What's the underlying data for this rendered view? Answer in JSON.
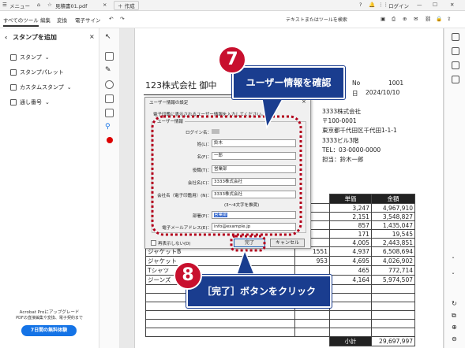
{
  "titlebar": {
    "menu": "メニュー",
    "tab_title": "見積書01.pdf",
    "new_tab": "作成",
    "login": "ログイン"
  },
  "toolbar": {
    "tabs": [
      "すべてのツール",
      "編集",
      "変換",
      "電子サイン"
    ],
    "search_placeholder": "テキストまたはツールを検索"
  },
  "left_panel": {
    "title": "スタンプを追加",
    "items": [
      "スタンプ",
      "スタンプパレット",
      "カスタムスタンプ",
      "通し番号"
    ],
    "promo_line1": "Acrobat Proにアップグレード",
    "promo_line2": "PDFの直接編集や変換、電子契約まで",
    "trial_button": "7日間の無料体験"
  },
  "document": {
    "company_title": "123株式会社 御中",
    "no_label": "No",
    "no_value": "1001",
    "date_label_partial": "日",
    "date_value": "2024/10/10",
    "issuer": [
      "3333株式会社",
      "〒100-0001",
      "東京都千代田区千代田1-1-1",
      "3333ビル3階",
      "TEL：03-0000-0000",
      "担当：鈴木一郎"
    ],
    "headers": [
      "単価",
      "金額"
    ],
    "rows": [
      {
        "item": "",
        "qty": "",
        "price": "3,247",
        "amount": "4,967,910"
      },
      {
        "item": "",
        "qty": "",
        "price": "2,151",
        "amount": "3,548,827"
      },
      {
        "item": "",
        "qty": "",
        "price": "857",
        "amount": "1,435,047"
      },
      {
        "item": "",
        "qty": "",
        "price": "171",
        "amount": "19,545"
      },
      {
        "item": "",
        "qty": "",
        "price": "4,005",
        "amount": "2,443,851"
      },
      {
        "item": "ジャケットB",
        "qty": "1551",
        "price": "4,937",
        "amount": "6,508,694"
      },
      {
        "item": "ジャケット",
        "qty": "953",
        "price": "4,695",
        "amount": "4,026,902"
      },
      {
        "item": "Tシャツ",
        "qty": "",
        "price": "465",
        "amount": "772,714"
      },
      {
        "item": "ジーンズ",
        "qty": "",
        "price": "4,164",
        "amount": "5,974,507"
      }
    ],
    "subtotal_label": "小計",
    "subtotal_value": "29,697,997"
  },
  "dialog": {
    "title": "ユーザー情報の設定",
    "description": "電子印鑑に表示されるユーザー情報を入力してください。",
    "group_label": "ユーザー情報",
    "login_label": "ログイン名：",
    "fields": [
      {
        "label": "姓(L)：",
        "value": "鈴木"
      },
      {
        "label": "名(F)：",
        "value": "一郎"
      },
      {
        "label": "役職(T)：",
        "value": "営業部"
      },
      {
        "label": "会社名(C)：",
        "value": "3333株式会社"
      },
      {
        "label": "会社名（電子印鑑用）(N)：",
        "value": "3333株式会社"
      }
    ],
    "hint": "(3～4文字を推奨)",
    "dept_label": "部署(P)：",
    "dept_value": "営業部",
    "email_label": "電子メールアドレス(E)：",
    "email_value": "info@example.jp",
    "checkbox_label": "再表示しない(D)",
    "ok": "完了",
    "cancel": "キャンセル"
  },
  "annotations": {
    "step7_number": "7",
    "step7_text": "ユーザー情報を確認",
    "step8_number": "8",
    "step8_text": "［完了］ボタンをクリック",
    "callout_color": "#1a3d8f",
    "badge_color": "#c8102e",
    "dotted_color": "#b3001b"
  }
}
